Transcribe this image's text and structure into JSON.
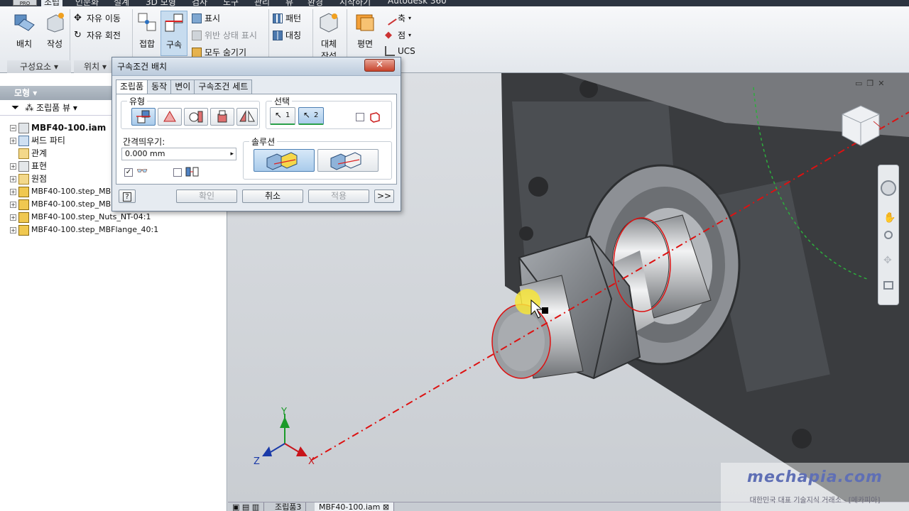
{
  "top_tabs": {
    "pro_badge": "PRO",
    "items": [
      "조립",
      "인문화",
      "설계",
      "3D 모형",
      "검사",
      "도구",
      "관리",
      "뷰",
      "환경",
      "시작하기",
      "Autodesk 360"
    ]
  },
  "ribbon": {
    "place_label": "배치",
    "create_label": "작성",
    "free_move_label": "자유 이동",
    "free_rotate_label": "자유 회전",
    "joint_label": "접합",
    "constrain_label": "구속",
    "show_label": "표시",
    "show_sick_label": "위반 상태 표시",
    "hide_all_label": "모두 숨기기",
    "pattern_label": "패턴",
    "mirror_label": "대칭",
    "substitute_label": "대체",
    "substitute_label2": "작성",
    "plane_label": "평면",
    "axis_label": "축",
    "point_label": "점",
    "ucs_label": "UCS",
    "panel_component": "구성요소",
    "panel_position": "위치"
  },
  "browser": {
    "title": "모형",
    "view_label": "조립품 뷰",
    "tree": [
      {
        "label": "MBF40-100.iam",
        "bold": true
      },
      {
        "label": "써드 파티"
      },
      {
        "label": "관계"
      },
      {
        "label": "표현"
      },
      {
        "label": "원점"
      },
      {
        "label": "MBF40-100.step_MB"
      },
      {
        "label": "MBF40-100.step_MB"
      },
      {
        "label": "MBF40-100.step_Nuts_NT-04:1"
      },
      {
        "label": "MBF40-100.step_MBFlange_40:1"
      }
    ]
  },
  "dialog": {
    "title": "구속조건 배치",
    "close": "✕",
    "tabs": [
      "조립품",
      "동작",
      "변이",
      "구속조건 세트"
    ],
    "type_label": "유형",
    "selection_label": "선택",
    "select1": "1",
    "select2": "2",
    "offset_label": "간격띄우기:",
    "offset_value": "0.000 mm",
    "solution_label": "솔루션",
    "ok": "확인",
    "cancel": "취소",
    "apply": "적용",
    "more": ">>",
    "help": "?"
  },
  "doc_tabs": [
    "조립품3",
    "MBF40-100.iam"
  ],
  "watermark": {
    "logo": "mechapia.com",
    "tagline": "대한민국 대표 기술지식 거래소 - [메카피아]"
  },
  "triad": {
    "x": "X",
    "y": "Y",
    "z": "Z"
  },
  "colors": {
    "constraint_red": "#dd1111",
    "triad_green": "#1b9a2a",
    "triad_blue": "#1a3aa8",
    "triad_red": "#c8141a"
  }
}
